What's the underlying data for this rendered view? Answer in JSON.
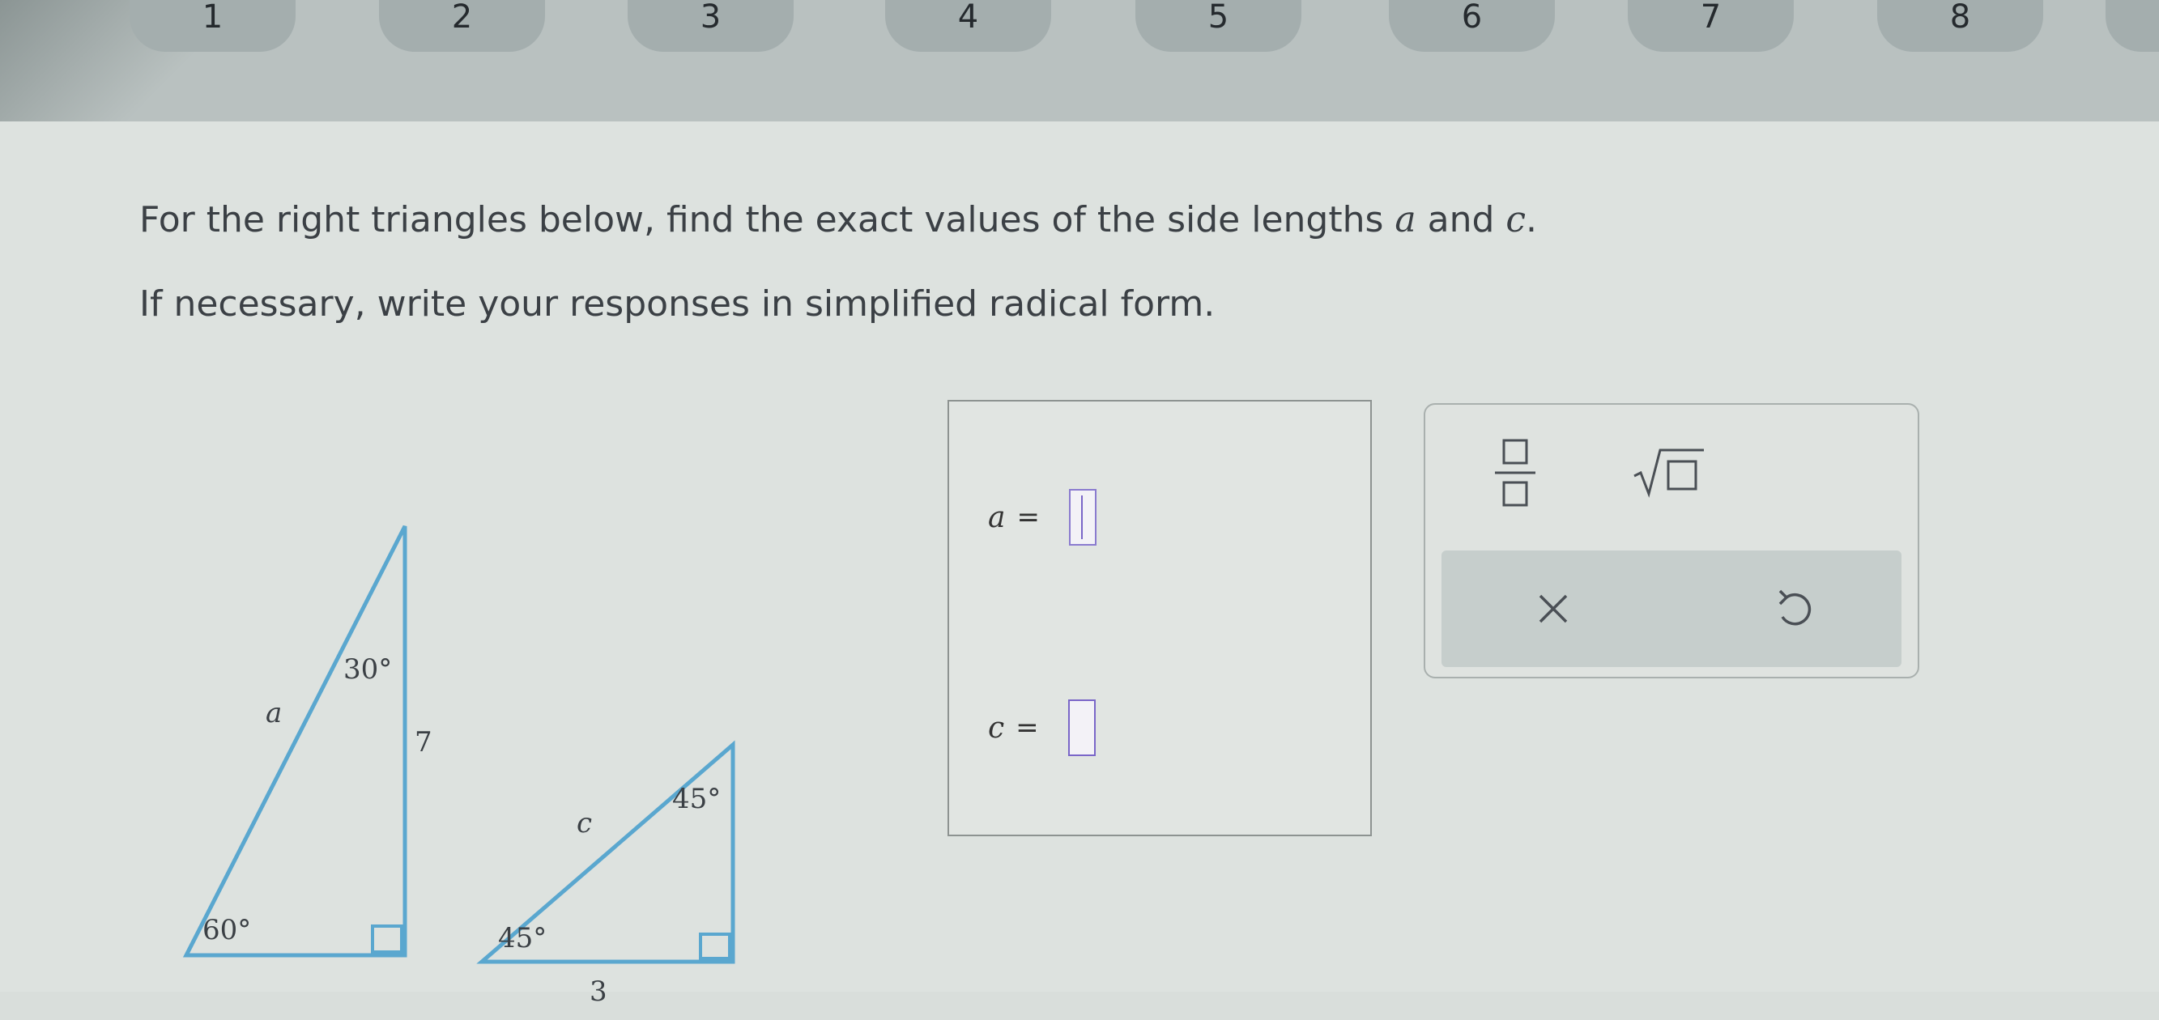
{
  "nav": {
    "questions": [
      "1",
      "2",
      "3",
      "4",
      "5",
      "6",
      "7",
      "8"
    ]
  },
  "instructions": {
    "line1_prefix": "For the right triangles below, find the exact values of the side lengths ",
    "var_a": "a",
    "line1_mid": " and ",
    "var_c": "c",
    "line1_suffix": ".",
    "line2": "If necessary, write your responses in simplified radical form."
  },
  "figures": {
    "triangle1": {
      "angle_top": "30°",
      "angle_bottom": "60°",
      "hypotenuse": "a",
      "vertical_side": "7"
    },
    "triangle2": {
      "angle_top": "45°",
      "angle_bottom": "45°",
      "hypotenuse": "c",
      "base": "3"
    }
  },
  "answers": {
    "a": {
      "variable": "a",
      "equals": "=",
      "value": ""
    },
    "c": {
      "variable": "c",
      "equals": "=",
      "value": ""
    }
  },
  "tools": {
    "fraction": "fraction-icon",
    "sqrt": "square-root-icon",
    "clear": "x-icon",
    "undo": "undo-icon"
  },
  "colors": {
    "input_border": "#7a66c8",
    "background": "#dde2df"
  }
}
